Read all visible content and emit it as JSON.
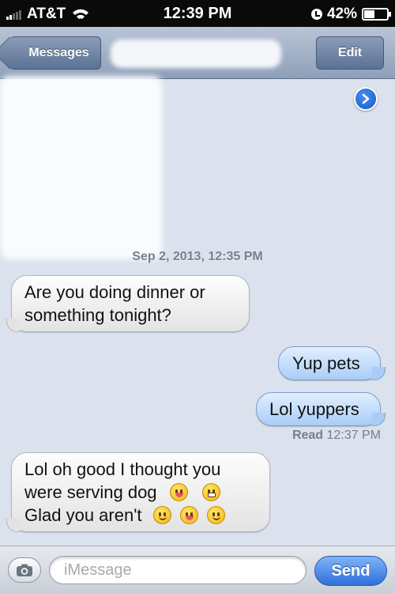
{
  "status_bar": {
    "carrier": "AT&T",
    "time": "12:39 PM",
    "battery": "42%"
  },
  "nav": {
    "back_label": "Messages",
    "edit_label": "Edit"
  },
  "conversation": {
    "timestamp": "Sep 2, 2013, 12:35 PM",
    "messages": [
      {
        "from": "them",
        "lines": [
          "Are you doing dinner or",
          "something tonight?"
        ]
      },
      {
        "from": "me",
        "text": "Yup pets"
      },
      {
        "from": "me",
        "text": "Lol yuppers"
      },
      {
        "from": "them",
        "lines": [
          "Lol oh good I thought you",
          "were serving dog",
          "Glad you aren't"
        ]
      }
    ],
    "read_receipt": {
      "label": "Read",
      "time": "12:37 PM"
    }
  },
  "input_bar": {
    "placeholder": "iMessage",
    "send_label": "Send"
  }
}
